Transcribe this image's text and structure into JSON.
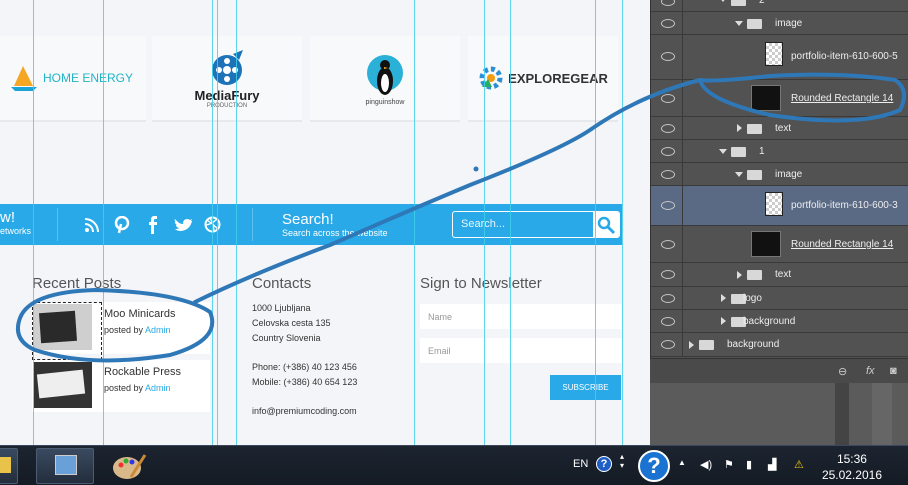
{
  "canvas": {
    "logos": [
      {
        "name": "HOME ENERGY",
        "sub": ""
      },
      {
        "name": "MediaFury",
        "sub": "PRODUCTION"
      },
      {
        "name": "",
        "sub": "pinguinshow"
      },
      {
        "name": "EXPLOREGEAR",
        "sub": ""
      }
    ],
    "bar": {
      "follow_title": "w!",
      "follow_sub": "etworks",
      "search_title": "Search!",
      "search_sub": "Search across the website",
      "search_placeholder": "Search...",
      "social_icons": [
        "rss-icon",
        "pinterest-icon",
        "facebook-icon",
        "twitter-icon",
        "dribbble-icon"
      ]
    },
    "recent_posts": {
      "title": "Recent Posts",
      "posts": [
        {
          "title": "Moo Minicards",
          "by": "posted by",
          "author": "Admin"
        },
        {
          "title": "Rockable Press",
          "by": "posted by",
          "author": "Admin"
        }
      ]
    },
    "contacts": {
      "title": "Contacts",
      "address": [
        "1000 Ljubljana",
        "Celovska cesta 135",
        "Country Slovenia"
      ],
      "phone": "Phone: (+386) 40 123 456",
      "mobile": "Mobile: (+386) 40 654 123",
      "email": "info@premiumcoding.com"
    },
    "newsletter": {
      "title": "Sign to Newsletter",
      "name_placeholder": "Name",
      "email_placeholder": "Email",
      "button": "SUBSCRIBE"
    }
  },
  "layers_panel": {
    "rows": [
      {
        "label": "2",
        "kind": "group",
        "expanded": true
      },
      {
        "label": "image",
        "kind": "group",
        "expanded": true
      },
      {
        "label": "portfolio-item-610-600-5",
        "kind": "smart"
      },
      {
        "label": "Rounded Rectangle 14",
        "kind": "shape"
      },
      {
        "label": "text",
        "kind": "group",
        "expanded": false
      },
      {
        "label": "1",
        "kind": "group",
        "expanded": true
      },
      {
        "label": "image",
        "kind": "group",
        "expanded": true
      },
      {
        "label": "portfolio-item-610-600-3",
        "kind": "smart",
        "selected": true
      },
      {
        "label": "Rounded Rectangle 14",
        "kind": "shape"
      },
      {
        "label": "text",
        "kind": "group",
        "expanded": false
      },
      {
        "label": "logo",
        "kind": "group",
        "expanded": false
      },
      {
        "label": "background",
        "kind": "group",
        "expanded": false
      },
      {
        "label": "background",
        "kind": "group",
        "expanded": false
      }
    ],
    "footer_icons": [
      "link-icon",
      "fx-icon",
      "mask-icon"
    ]
  },
  "taskbar": {
    "language": "EN",
    "time": "15:36",
    "date": "25.02.2016",
    "apps": [
      "windows-explorer-icon",
      "network-monitor-icon",
      "paint-icon"
    ],
    "tray_icons": [
      "show-hidden-icon",
      "volume-icon",
      "flag-icon",
      "power-icon",
      "network-icon",
      "warning-icon"
    ]
  },
  "colors": {
    "accent": "#29a9e8",
    "panel": "#525252",
    "selected_layer": "#5a6a85",
    "annotation": "#2f78b8"
  }
}
